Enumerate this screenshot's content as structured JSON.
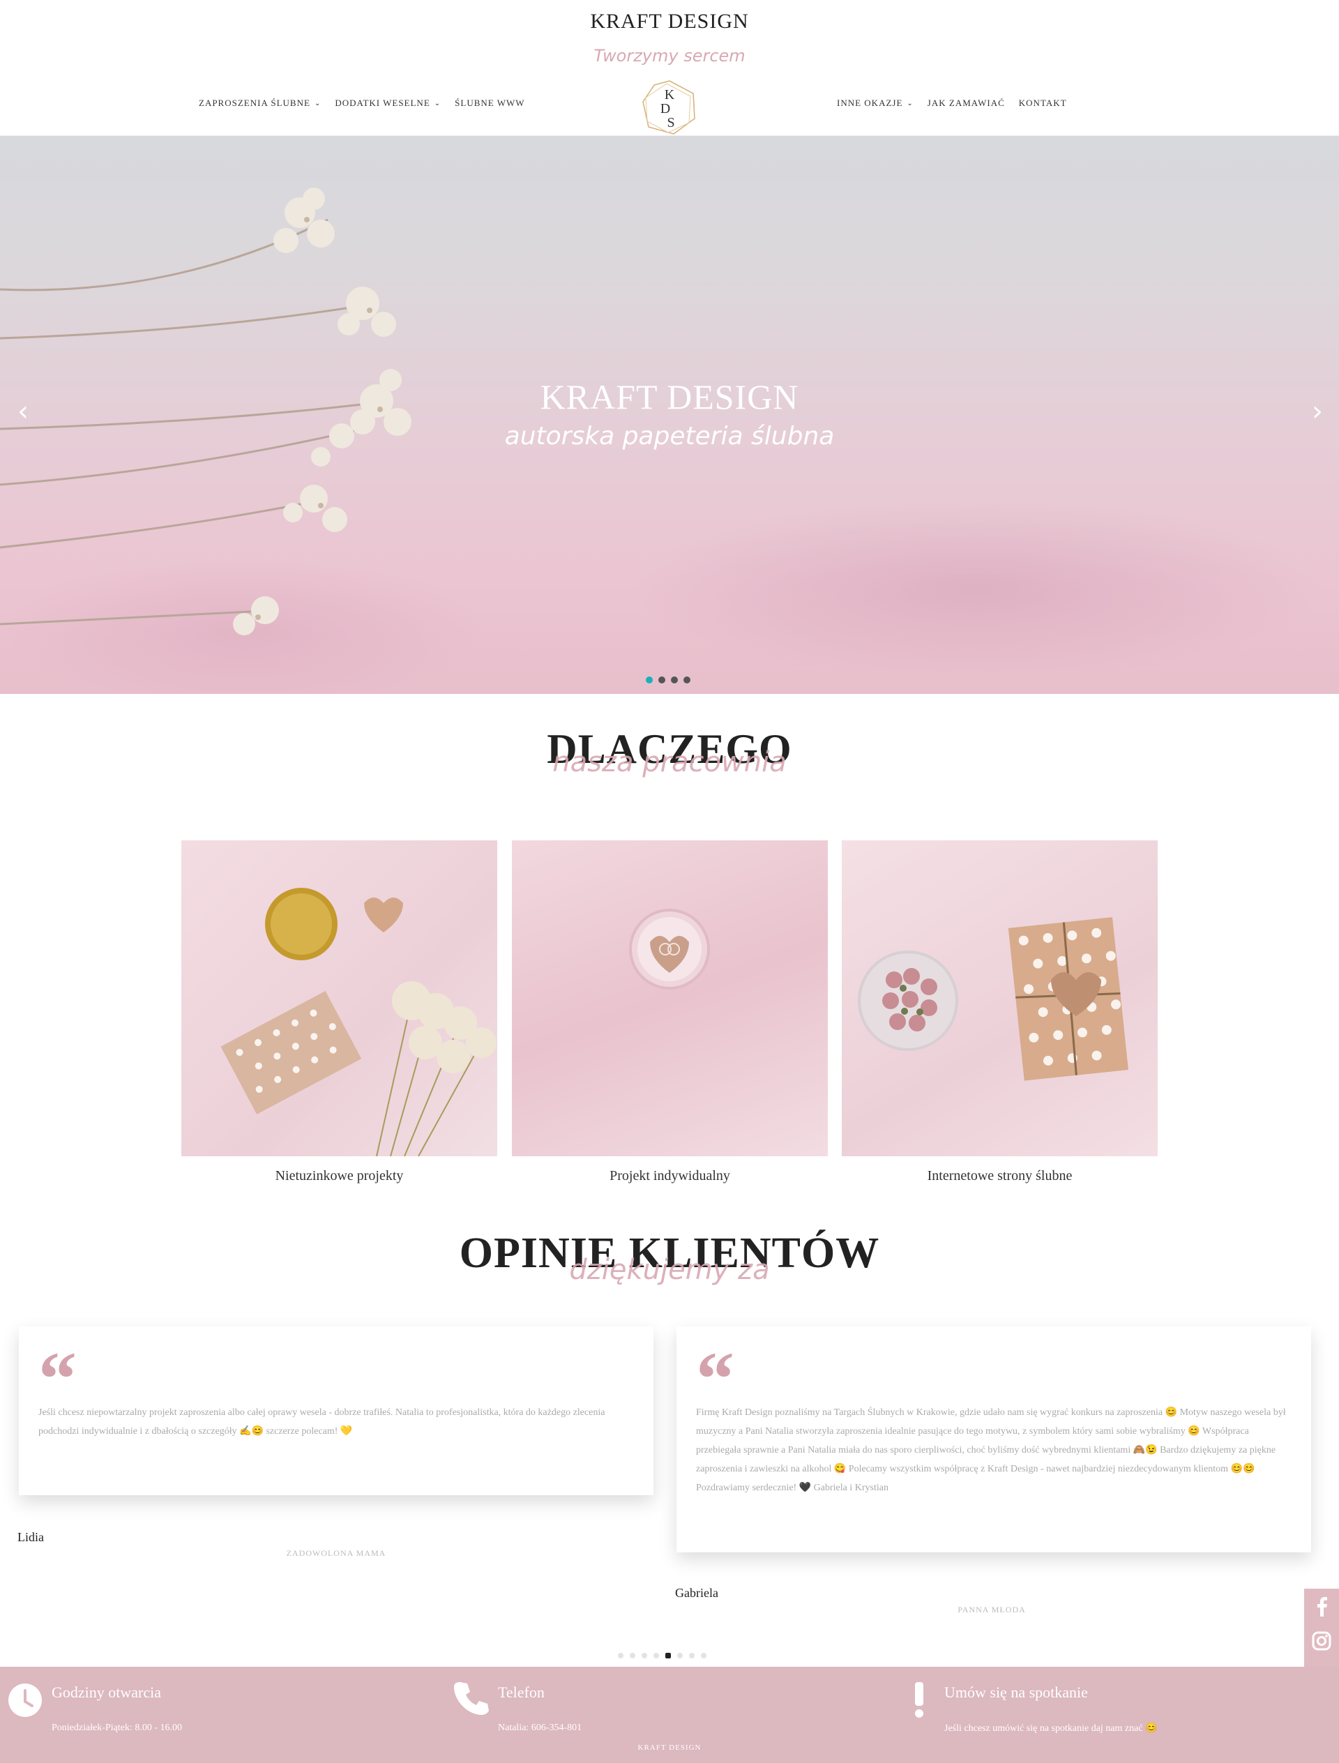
{
  "header": {
    "title": "KRAFT DESIGN",
    "tagline": "Tworzymy sercem",
    "logo_letters": "KDS",
    "nav_left": [
      {
        "label": "ZAPROSZENIA ŚLUBNE",
        "dropdown": true
      },
      {
        "label": "DODATKI WESELNE",
        "dropdown": true
      },
      {
        "label": "ŚLUBNE WWW",
        "dropdown": false
      }
    ],
    "nav_right": [
      {
        "label": "INNE OKAZJE",
        "dropdown": true
      },
      {
        "label": "JAK ZAMAWIAĆ",
        "dropdown": false
      },
      {
        "label": "KONTAKT",
        "dropdown": false
      }
    ],
    "caret": "⌄"
  },
  "hero": {
    "title": "KRAFT DESIGN",
    "subtitle": "autorska papeteria ślubna",
    "prev_arrow": "‹",
    "next_arrow": "›",
    "slides_count": 4,
    "active_slide": 1
  },
  "why": {
    "title": "DLACZEGO",
    "script": "nasza pracownia",
    "cards": [
      {
        "label": "Nietuzinkowe projekty"
      },
      {
        "label": "Projekt indywidualny"
      },
      {
        "label": "Internetowe strony ślubne"
      }
    ]
  },
  "reviews": {
    "title": "OPINIE KLIENTÓW",
    "script": "dziękujemy za",
    "quote_glyph": "“",
    "items": [
      {
        "text": "Jeśli chcesz niepowtarzalny projekt zaproszenia albo całej oprawy wesela - dobrze trafiłeś. Natalia to profesjonalistka, która do każdego zlecenia podchodzi indywidualnie i z dbałością o szczegóły ✍😊 szczerze polecam! 💛",
        "name": "Lidia",
        "role": "ZADOWOLONA MAMA"
      },
      {
        "text": "Firmę Kraft Design poznaliśmy na Targach Ślubnych w Krakowie, gdzie udało nam się wygrać konkurs na zaproszenia 😊 Motyw naszego wesela był muzyczny a Pani Natalia stworzyła zaproszenia idealnie pasujące do tego motywu, z symbolem który sami sobie wybraliśmy 😊 Współpraca przebiegała sprawnie a Pani Natalia miała do nas sporo cierpliwości, choć byliśmy dość wybrednymi klientami 🙈😉 Bardzo dziękujemy za piękne zaproszenia i zawieszki na alkohol 😋 Polecamy wszystkim współpracę z Kraft Design - nawet najbardziej niezdecydowanym klientom 😊😊 Pozdrawiamy serdecznie! 🖤 Gabriela i Krystian",
        "name": "Gabriela",
        "role": "PANNA MŁODA"
      }
    ],
    "dots_count": 8,
    "active_dot": 5
  },
  "social": [
    "facebook-icon",
    "instagram-icon",
    "envelope-icon",
    "phone-icon"
  ],
  "footer": {
    "cols": [
      {
        "icon": "clock-icon",
        "title": "Godziny otwarcia",
        "text": "Poniedziałek-Piątek: 8.00 - 16.00"
      },
      {
        "icon": "phone-icon",
        "title": "Telefon",
        "text": "Natalia: 606-354-801"
      },
      {
        "icon": "exclamation-icon",
        "title": "Umów się na spotkanie",
        "text": "Jeśli chcesz umówić się na spotkanie daj nam znać 😊"
      }
    ],
    "bottom": "KRAFT DESIGN"
  },
  "colors": {
    "accent_pink": "#d9a8b3",
    "footer_bg": "#dcb8bf",
    "dot_active": "#1ab1b8"
  }
}
